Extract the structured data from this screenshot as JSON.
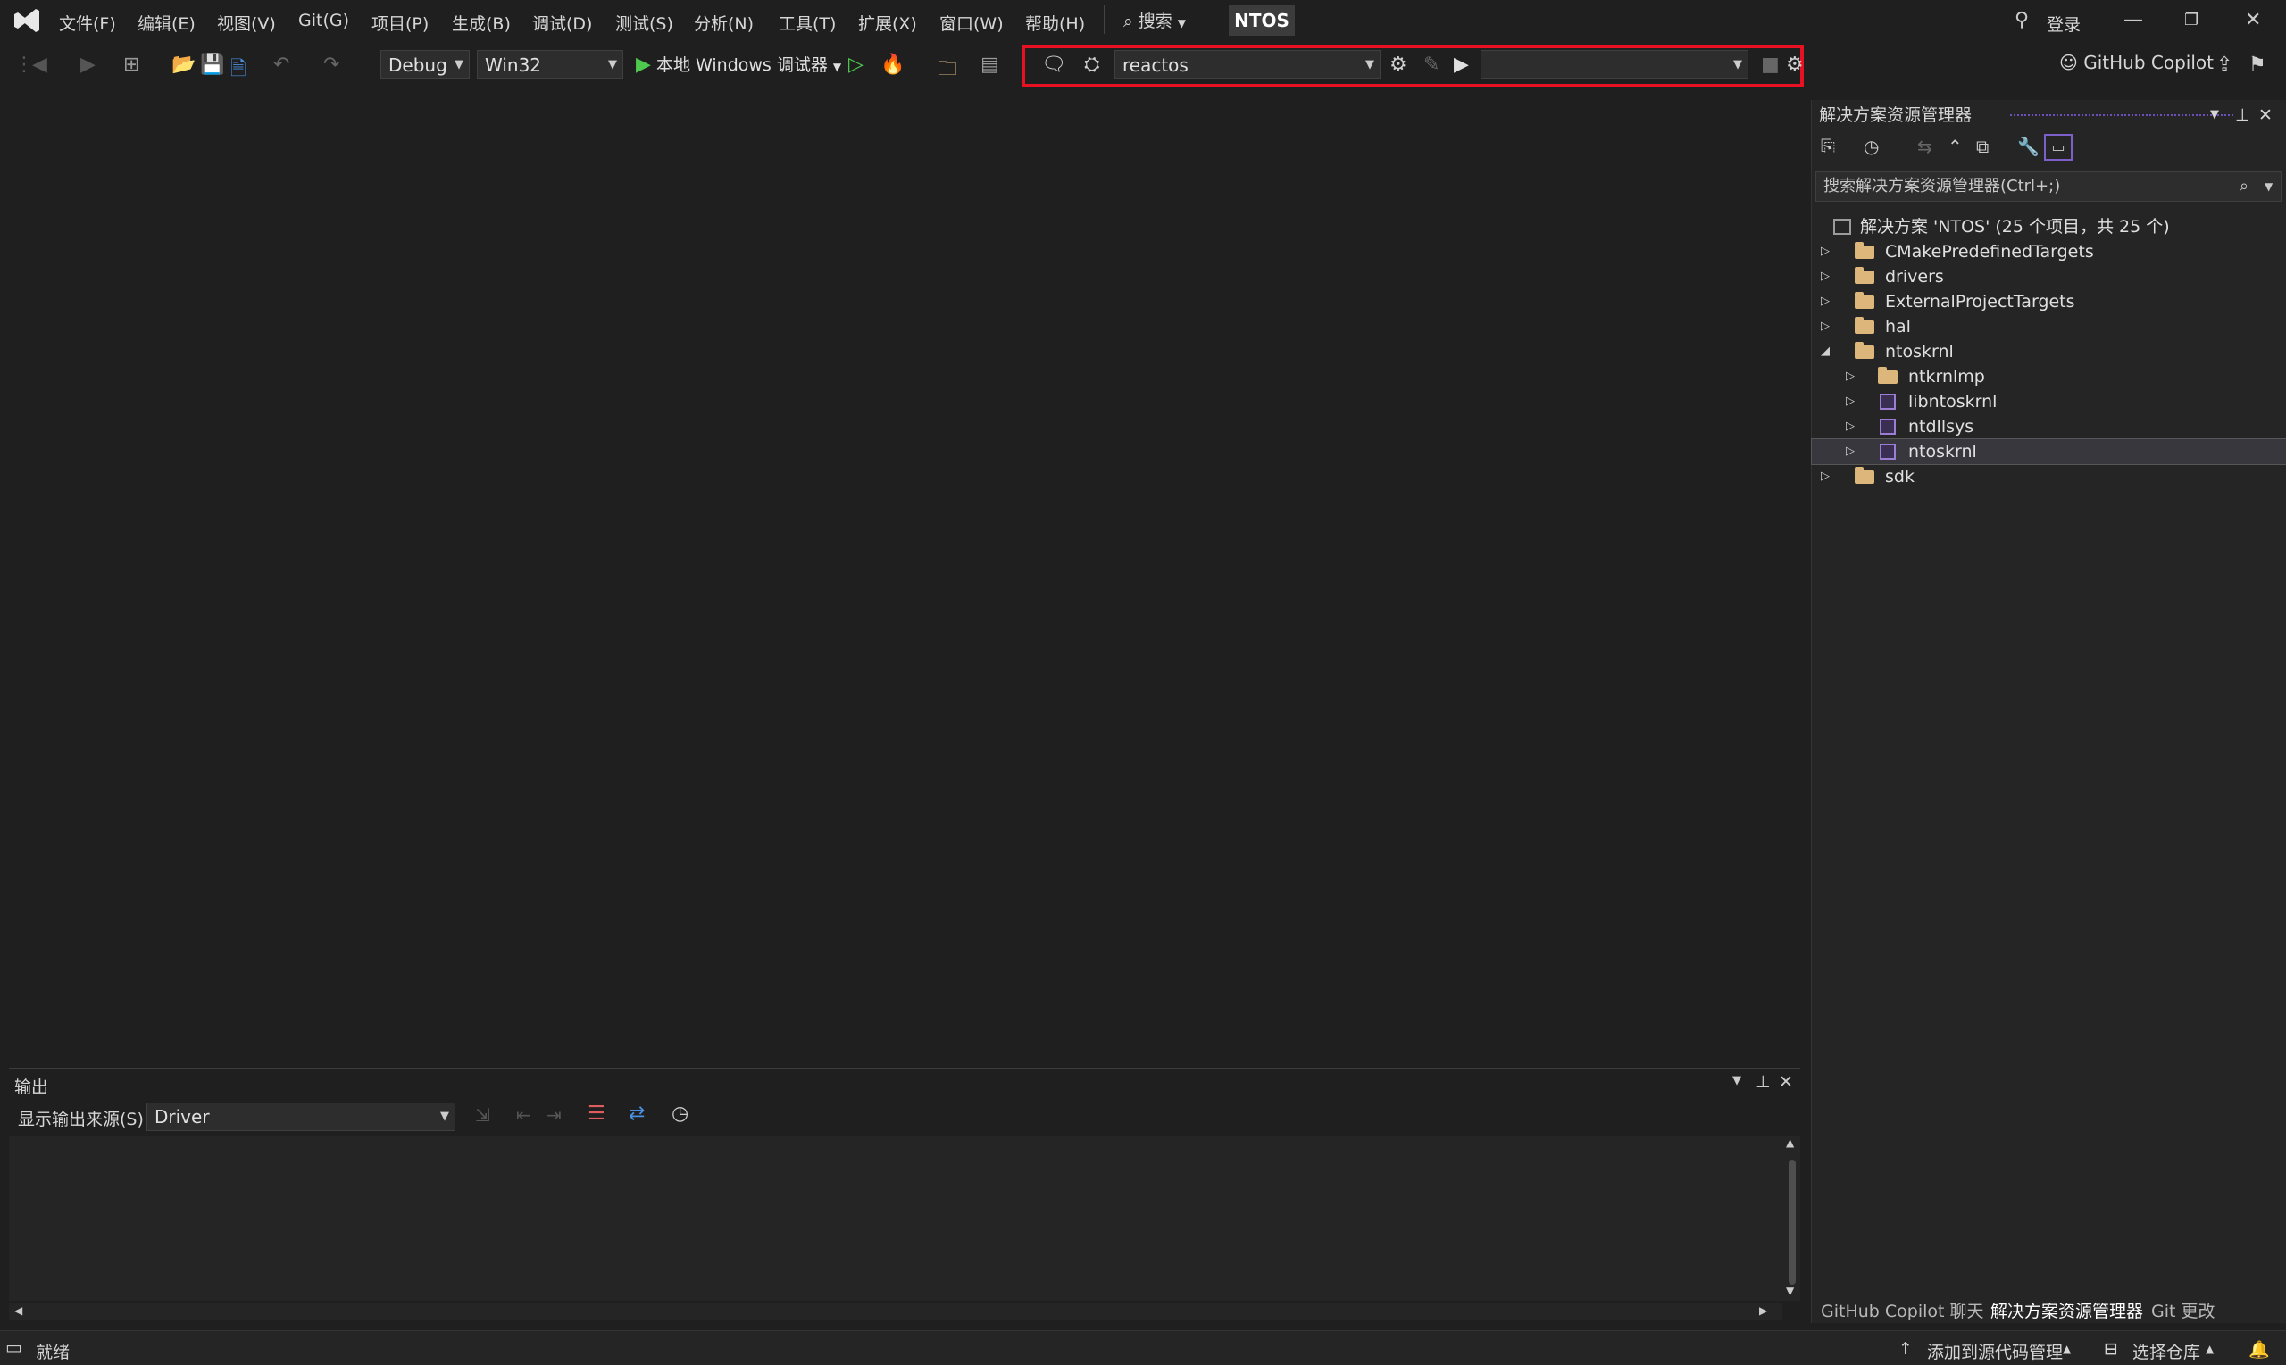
{
  "menu": [
    "文件(F)",
    "编辑(E)",
    "视图(V)",
    "Git(G)",
    "项目(P)",
    "生成(B)",
    "调试(D)",
    "测试(S)",
    "分析(N)",
    "工具(T)",
    "扩展(X)",
    "窗口(W)",
    "帮助(H)"
  ],
  "search_label": "搜索",
  "solution_badge": "NTOS",
  "login_label": "登录",
  "toolbar": {
    "config": "Debug",
    "platform": "Win32",
    "run_label": "本地 Windows 调试器",
    "target_combo": "reactos",
    "empty_combo": "",
    "copilot_label": "GitHub Copilot"
  },
  "solution_explorer": {
    "title": "解决方案资源管理器",
    "search_placeholder": "搜索解决方案资源管理器(Ctrl+;)",
    "solution_node": "解决方案 'NTOS' (25 个项目，共 25 个)",
    "items": [
      {
        "label": "CMakePredefinedTargets",
        "type": "folder",
        "expanded": false
      },
      {
        "label": "drivers",
        "type": "folder",
        "expanded": false
      },
      {
        "label": "ExternalProjectTargets",
        "type": "folder",
        "expanded": false
      },
      {
        "label": "hal",
        "type": "folder",
        "expanded": false
      },
      {
        "label": "ntoskrnl",
        "type": "folder",
        "expanded": true
      },
      {
        "label": "ntkrnlmp",
        "type": "folder",
        "expanded": false
      },
      {
        "label": "libntoskrnl",
        "type": "project",
        "expanded": false
      },
      {
        "label": "ntdllsys",
        "type": "project",
        "expanded": false
      },
      {
        "label": "ntoskrnl",
        "type": "project",
        "expanded": false,
        "selected": true
      },
      {
        "label": "sdk",
        "type": "folder",
        "expanded": false
      }
    ],
    "tabs": [
      "GitHub Copilot 聊天",
      "解决方案资源管理器",
      "Git 更改"
    ]
  },
  "output": {
    "title": "输出",
    "source_label": "显示输出来源(S):",
    "source_value": "Driver"
  },
  "status": {
    "ready": "就绪",
    "add_source": "添加到源代码管理",
    "select_repo": "选择仓库"
  },
  "colors": {
    "highlight": "#e81123",
    "folder": "#dcb67a",
    "run_green": "#4ec94e"
  }
}
